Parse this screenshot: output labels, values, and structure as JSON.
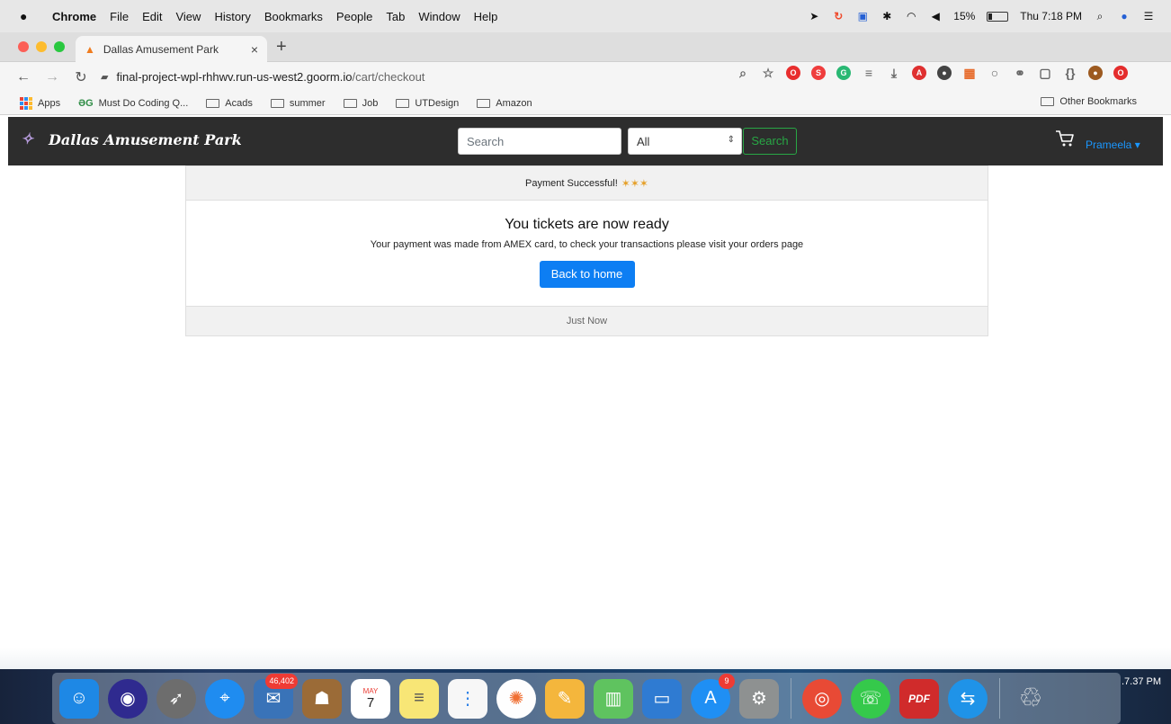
{
  "menubar": {
    "app": "Chrome",
    "items": [
      "File",
      "Edit",
      "View",
      "History",
      "Bookmarks",
      "People",
      "Tab",
      "Window",
      "Help"
    ],
    "battery": "15%",
    "time": "Thu 7:18 PM"
  },
  "browser": {
    "tab_title": "Dallas Amusement Park",
    "url_host": "final-project-wpl-rhhwv.run-us-west2.goorm.io",
    "url_path": "/cart/checkout",
    "bookmarks": [
      "Apps",
      "Must Do Coding Q...",
      "Acads",
      "summer",
      "Job",
      "UTDesign",
      "Amazon"
    ],
    "other_bookmarks": "Other Bookmarks"
  },
  "app": {
    "brand": "Dallas Amusement Park",
    "search": {
      "placeholder": "Search"
    },
    "category": "All",
    "search_button": "Search",
    "user": "Prameela"
  },
  "payment": {
    "header": "Payment Successful!",
    "title": "You tickets are now ready",
    "message": "Your payment was made from AMEX card, to check your transactions please visit your orders page",
    "button": "Back to home",
    "footer": "Just Now"
  },
  "dock": {
    "mail_badge": "46,402",
    "calendar_month": "MAY",
    "calendar_day": "7",
    "appstore_badge": "9",
    "pdf_label": "PDF",
    "corner_time": ".7.37 PM"
  },
  "colors": {
    "navbar": "#2d2d2d",
    "primary": "#0d7ef3",
    "success": "#28a745",
    "link": "#1a97ff"
  }
}
